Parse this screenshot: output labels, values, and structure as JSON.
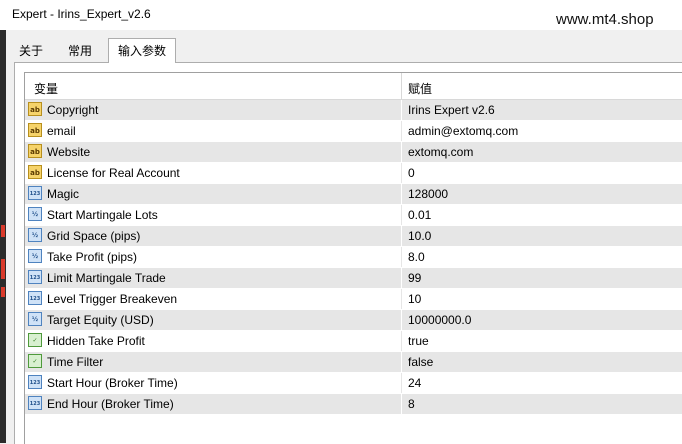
{
  "window": {
    "title": "Expert - Irins_Expert_v2.6"
  },
  "watermark": "www.mt4.shop",
  "tabs": [
    {
      "label": "关于"
    },
    {
      "label": "常用"
    },
    {
      "label": "输入参数",
      "active": true
    }
  ],
  "table": {
    "columns": [
      "变量",
      "赋值"
    ],
    "rows": [
      {
        "icon": "string-type-icon",
        "name": "Copyright",
        "value": "Irins Expert v2.6"
      },
      {
        "icon": "string-type-icon",
        "name": "email",
        "value": "admin@extomq.com"
      },
      {
        "icon": "string-type-icon",
        "name": "Website",
        "value": "extomq.com"
      },
      {
        "icon": "string-type-icon",
        "name": "License for Real Account",
        "value": "0"
      },
      {
        "icon": "integer-type-icon",
        "name": "Magic",
        "value": "128000"
      },
      {
        "icon": "double-type-icon",
        "name": "Start Martingale Lots",
        "value": "0.01"
      },
      {
        "icon": "double-type-icon",
        "name": "Grid Space (pips)",
        "value": "10.0"
      },
      {
        "icon": "double-type-icon",
        "name": "Take Profit (pips)",
        "value": "8.0"
      },
      {
        "icon": "integer-type-icon",
        "name": "Limit Martingale Trade",
        "value": "99"
      },
      {
        "icon": "integer-type-icon",
        "name": "Level Trigger Breakeven",
        "value": "10"
      },
      {
        "icon": "double-type-icon",
        "name": "Target Equity (USD)",
        "value": "10000000.0"
      },
      {
        "icon": "bool-type-icon",
        "name": "Hidden Take Profit",
        "value": "true"
      },
      {
        "icon": "bool-type-icon",
        "name": "Time Filter",
        "value": "false"
      },
      {
        "icon": "integer-type-icon",
        "name": "Start Hour (Broker Time)",
        "value": "24"
      },
      {
        "icon": "integer-type-icon",
        "name": "End Hour (Broker Time)",
        "value": "8"
      }
    ]
  }
}
